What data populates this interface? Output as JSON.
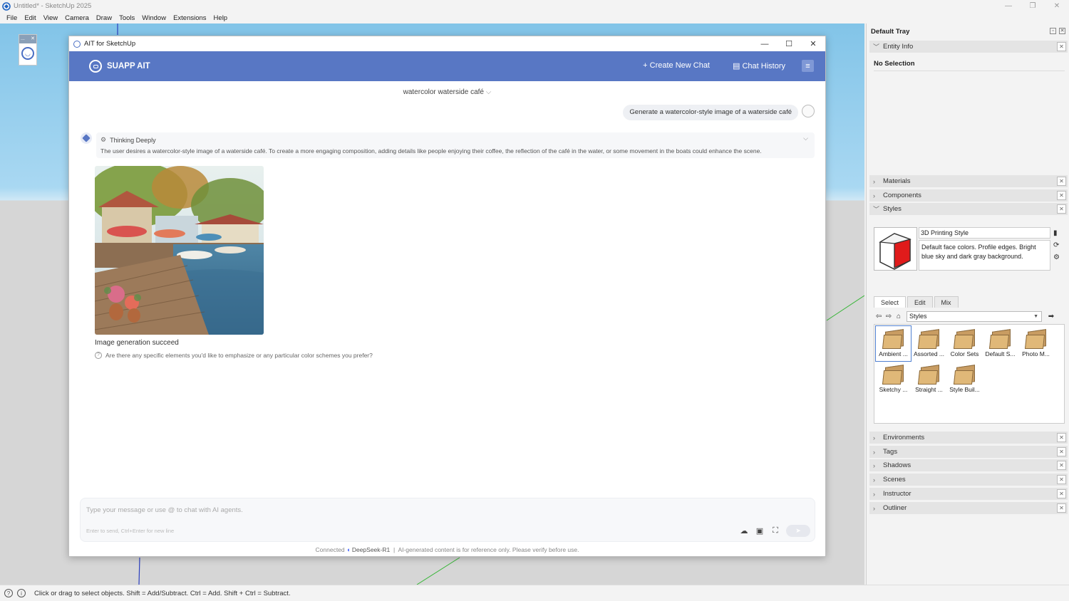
{
  "app": {
    "title": "Untitled* - SketchUp 2025",
    "menu": [
      "File",
      "Edit",
      "View",
      "Camera",
      "Draw",
      "Tools",
      "Window",
      "Extensions",
      "Help"
    ],
    "window_controls": [
      "—",
      "❐",
      "✕"
    ]
  },
  "mini_toolbar": {
    "label": "...",
    "close": "✕"
  },
  "status_bar": {
    "text": "Click or drag to select objects. Shift = Add/Subtract. Ctrl = Add. Shift + Ctrl = Subtract."
  },
  "dialog": {
    "title": "AIT for SketchUp",
    "controls": [
      "—",
      "☐",
      "✕"
    ],
    "brand": "SUAPP AIT",
    "create_new_chat": "+ Create New Chat",
    "chat_history": "Chat History",
    "chat_title": "watercolor waterside café",
    "user_message": "Generate a watercolor-style image of a waterside café",
    "thinking": {
      "label": "Thinking Deeply",
      "text": "The user desires a watercolor-style image of a waterside café. To create a more engaging composition, adding details like people enjoying their coffee, the reflection of the café in the water, or some movement in the boats could enhance the scene."
    },
    "image_caption": "Image generation succeed",
    "followup": "Are there any specific elements you'd like to emphasize or any particular color schemes you prefer?",
    "input": {
      "placeholder": "Type your message or use @ to chat with AI agents.",
      "hint": "Enter to send, Ctrl+Enter for new line"
    },
    "footer": {
      "status": "Connected",
      "model": "DeepSeek-R1",
      "separator": "|",
      "disclaimer": "AI-generated content is for reference only. Please verify before use."
    }
  },
  "tray": {
    "title": "Default Tray",
    "entity_info": "Entity Info",
    "no_selection": "No Selection",
    "panels_top": [
      "Materials",
      "Components",
      "Styles"
    ],
    "style": {
      "name": "3D Printing Style",
      "description": "Default face colors. Profile edges. Bright blue sky and dark gray background."
    },
    "style_tabs": [
      "Select",
      "Edit",
      "Mix"
    ],
    "style_dropdown": "Styles",
    "style_items": [
      "Ambient ...",
      "Assorted ...",
      "Color Sets",
      "Default S...",
      "Photo M...",
      "Sketchy ...",
      "Straight ...",
      "Style Buil..."
    ],
    "panels_bottom": [
      "Environments",
      "Tags",
      "Shadows",
      "Scenes",
      "Instructor",
      "Outliner"
    ]
  },
  "colors": {
    "header_blue": "#5877c4",
    "sky": "#a9d8f2",
    "ground": "#d6d6d6"
  }
}
